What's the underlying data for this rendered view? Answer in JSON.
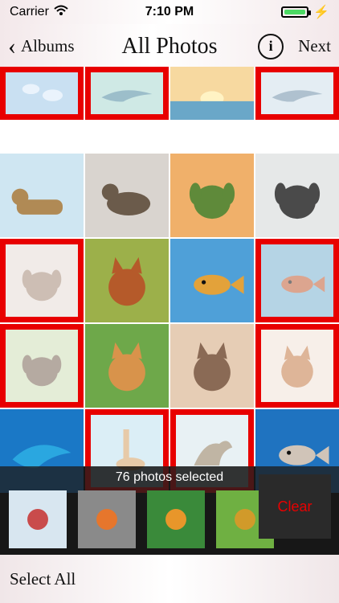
{
  "status": {
    "carrier": "Carrier",
    "time": "7:10 PM"
  },
  "nav": {
    "back": "Albums",
    "title": "All Photos",
    "info": "i",
    "next": "Next"
  },
  "grid": {
    "tiles": [
      {
        "name": "tile-jellyfish",
        "selected": true,
        "icon": "jellyfish",
        "c1": "#9ec7e8",
        "c2": "#3a6fa6"
      },
      {
        "name": "tile-dolphin-jump",
        "selected": true,
        "icon": "dolphin",
        "c1": "#a8d8d0",
        "c2": "#4c8aa0"
      },
      {
        "name": "tile-sunset-sea",
        "selected": false,
        "icon": "sunset",
        "c1": "#f7d9a0",
        "c2": "#6aa7c8"
      },
      {
        "name": "tile-dolphin-surf",
        "selected": true,
        "icon": "dolphin",
        "c1": "#cfe0ea",
        "c2": "#6e8fa8"
      },
      {
        "name": "tile-lioness",
        "selected": false,
        "icon": "lion",
        "c1": "#cfe6f2",
        "c2": "#b08a55"
      },
      {
        "name": "tile-lynx-snow",
        "selected": false,
        "icon": "lynx",
        "c1": "#d9d4cf",
        "c2": "#6b5b4b"
      },
      {
        "name": "tile-dog-run",
        "selected": false,
        "icon": "dog",
        "c1": "#f0b06a",
        "c2": "#5f8a3a"
      },
      {
        "name": "tile-husky",
        "selected": false,
        "icon": "dog",
        "c1": "#e6e8e8",
        "c2": "#4a4a4a"
      },
      {
        "name": "tile-pug",
        "selected": true,
        "icon": "dog",
        "c1": "#e6dcd6",
        "c2": "#a58a78"
      },
      {
        "name": "tile-cheetah",
        "selected": false,
        "icon": "cat",
        "c1": "#9cb04a",
        "c2": "#b55a2a"
      },
      {
        "name": "tile-fish-school",
        "selected": false,
        "icon": "fish",
        "c1": "#4fa0d8",
        "c2": "#e3a23a"
      },
      {
        "name": "tile-lionfish-reef",
        "selected": true,
        "icon": "fish",
        "c1": "#7ab1d1",
        "c2": "#c05c35"
      },
      {
        "name": "tile-angry-dog",
        "selected": true,
        "icon": "dog",
        "c1": "#cfe0b8",
        "c2": "#7a6655"
      },
      {
        "name": "tile-cat-grass",
        "selected": false,
        "icon": "cat",
        "c1": "#6ea84a",
        "c2": "#d8934b"
      },
      {
        "name": "tile-fluffy-cat",
        "selected": false,
        "icon": "cat",
        "c1": "#e6cdb5",
        "c2": "#8a6a55"
      },
      {
        "name": "tile-cat-sitting",
        "selected": true,
        "icon": "cat",
        "c1": "#f1e2d8",
        "c2": "#c47a44"
      },
      {
        "name": "tile-dolphins-underwater",
        "selected": false,
        "icon": "dolphin",
        "c1": "#1a78c6",
        "c2": "#2aa7e0"
      },
      {
        "name": "tile-giraffes",
        "selected": true,
        "icon": "giraffe",
        "c1": "#bfe1ef",
        "c2": "#d5a062"
      },
      {
        "name": "tile-dinosaur",
        "selected": true,
        "icon": "dinosaur",
        "c1": "#d6e6ec",
        "c2": "#8e7a5a"
      },
      {
        "name": "tile-lionfish",
        "selected": false,
        "icon": "fish",
        "c1": "#1f73c0",
        "c2": "#d0c4b8"
      }
    ]
  },
  "selection": {
    "summary": "76 photos selected",
    "clear_label": "Clear",
    "thumbs": [
      {
        "name": "thumb-kids-playing",
        "c1": "#d8e6f0",
        "c2": "#c94b4b"
      },
      {
        "name": "thumb-flower",
        "c1": "#8a8a8a",
        "c2": "#e6762c"
      },
      {
        "name": "thumb-butterflies",
        "c1": "#3a8a3a",
        "c2": "#e8962a"
      },
      {
        "name": "thumb-lizard",
        "c1": "#6fb042",
        "c2": "#d19a2a"
      }
    ]
  },
  "bottom": {
    "select_all": "Select All"
  }
}
